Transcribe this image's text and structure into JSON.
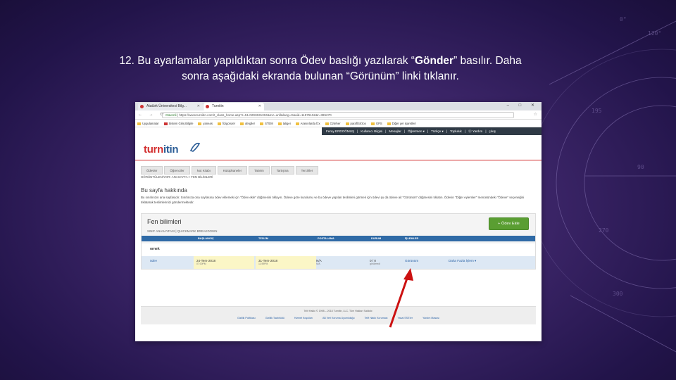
{
  "caption": {
    "line1_before": "12. Bu ayarlamalar yapıldıktan sonra Ödev baslığı yazılarak “",
    "line1_bold": "Gönder",
    "line1_after": "” basılır. Daha",
    "line2": "sonra aşağıdaki ekranda bulunan “Görünüm” linki tıklanır."
  },
  "browser": {
    "tabs": [
      {
        "label": "Atatürk Üniversitesi Bilg..."
      },
      {
        "label": "Turnitin"
      }
    ],
    "window_buttons": "– □ ✕",
    "nav_buttons": "← → ⟳",
    "url_secure": "Güvenli",
    "url": "https://www.turnitin.com/t_class_home.asp?r=51.0293631304&svr=unll&lang=tr&aid=11575152&r=385270",
    "bookmarks": [
      {
        "label": "Uygulamalar",
        "red": false
      },
      {
        "label": "Sistem Giriş Bilgile",
        "red": true
      },
      {
        "label": "yaneas",
        "red": false
      },
      {
        "label": "fizigoruler",
        "red": false
      },
      {
        "label": "dergiler",
        "red": false
      },
      {
        "label": "STEM",
        "red": false
      },
      {
        "label": "taligei",
        "red": false
      },
      {
        "label": "Arasınlarda fzx",
        "red": false
      },
      {
        "label": "Ozteher",
        "red": false
      },
      {
        "label": "paraflzxfzox",
        "red": false
      },
      {
        "label": "GPS",
        "red": false
      },
      {
        "label": "Diğer yer işaretleri",
        "red": false
      }
    ]
  },
  "turnitin": {
    "user_strip": [
      "Feray ERDOĞMUŞ",
      "|",
      "Kullanıcı Bilgisi",
      "|",
      "Mesajlar",
      "|",
      "Öğretmen ▾",
      "|",
      "Türkçe ▾",
      "|",
      "Topluluk",
      "|",
      "⓪ Yardım",
      "|",
      "çıkış"
    ],
    "logo_red": "turn",
    "logo_dark": "itin",
    "nav_tabs": [
      "Ödevler",
      "Öğrenciler",
      "Not Kitabı",
      "Kütüphaneler",
      "Takvim",
      "Tartışma",
      "Tercihler"
    ],
    "breadcrumb": "GÖRÜNTÜLENİYOR: ANASAYFA > FEN BİLİMLERİ",
    "about_title": "Bu sayfa hakkında",
    "about_text": "Bu sınıfınızın ana sayfasıdır. Sınıfınıza ona sayfasına ödev eklemek için \"Ödev ekle\" düğmesini tıklayın. Ödeve göre kurulumu ve bu ödeve yapılan teslimleri görmek için ödevi şu da ödeve ait \"Görünüm\" düğmesini tıklatın. Ödevin \"Diğer eylemler\" menüsündeki \"Ödeve\" seçeneğini tıklatarak teslimlerinizi göndermektedir.",
    "panel_title": "Fen bilimleri",
    "panel_sub": "SINIF ANASAYFASI | QUICKMARK BREAKDOWN",
    "add_button": "+ Ödev Ekle",
    "columns": [
      "BAŞLANGIÇ",
      "TESLİM",
      "POSTALAMA",
      "DURUM",
      "İŞLEMLER"
    ],
    "class_row": "ornek",
    "assignment": {
      "name": "ödev",
      "start": "24-Tem-2018",
      "start_time": "07:00PM",
      "due": "31-Tem-2018",
      "due_time": "11:59PM",
      "post": "N/A",
      "post_small": "N/A",
      "status": "0 / 0",
      "status_small": "görülmedi",
      "view_link": "Görünüm",
      "more_actions": "Daha Fazla İşlem ▾"
    },
    "copyright": "Telif Hakkı © 1998 – 2018 Turnitin, LLC. Tüm Hakları Saklıdır.",
    "footer_links": [
      "Gizlilik Politikası",
      "Gizlilik Taahhüdü",
      "Hizmet Koşulları",
      "AB Veri Koruma Uyumluluğu",
      "Telif Hakkı Koruması",
      "Yasal SSS'ler",
      "Yardım Masası"
    ]
  },
  "colors": {
    "turnitin_red": "#d32f2f",
    "header_blue": "#2f6aa6",
    "add_green": "#5a9e32",
    "arrow_red": "#cc1111"
  }
}
